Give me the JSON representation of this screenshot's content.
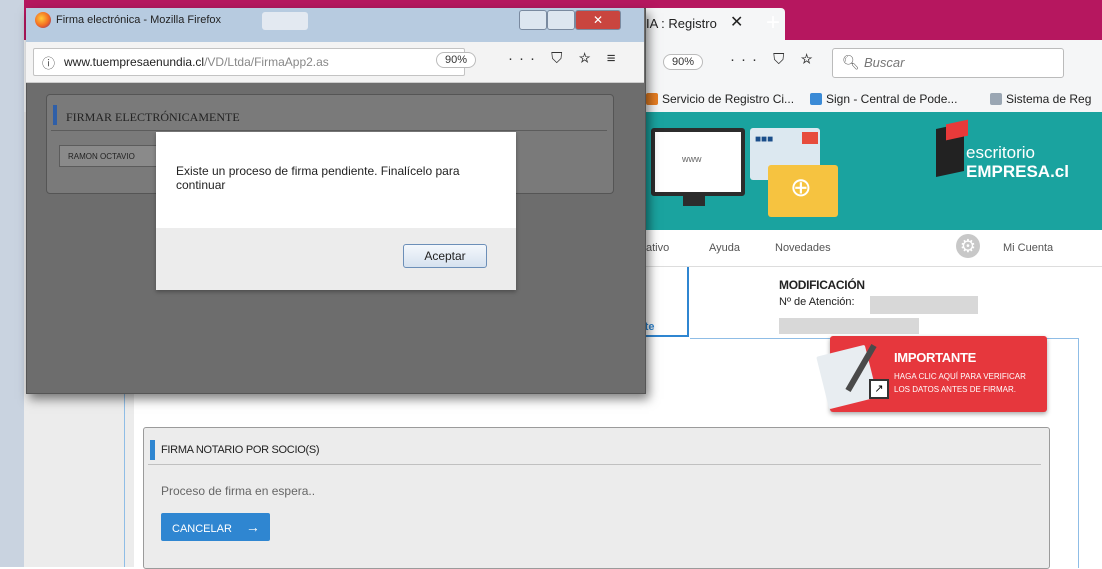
{
  "popup": {
    "title": "Firma electrónica - Mozilla Firefox",
    "url_domain": "www.tuempresaenundia.cl",
    "url_path": "/VD/Ltda/FirmaApp2.as",
    "zoom": "90%",
    "tools": "··· ⛉ ☆ ≡",
    "close_label": "✕"
  },
  "firmar": {
    "title": "FIRMAR ELECTRÓNICAMENTE",
    "signer": "RAMON OCTAVIO"
  },
  "alert": {
    "message": "Existe un proceso de firma pendiente. Finalícelo para continuar",
    "accept_label": "Aceptar"
  },
  "browser": {
    "tab_title": "IA : Registro",
    "tab_close": "✕",
    "new_tab": "+",
    "zoom": "90%",
    "tools": "··· ⛉ ☆",
    "search_placeholder": "Buscar",
    "bookmarks": [
      "Servicio de Registro Ci...",
      "Sign - Central de Pode...",
      "Sistema de Reg"
    ]
  },
  "site": {
    "logo_line1": "escritorio",
    "logo_line2": "EMPRESA.cl",
    "monitor_text": "www",
    "nav": [
      "ativo",
      "Ayuda",
      "Novedades",
      "Mi Cuenta"
    ],
    "tab_label": "nte",
    "modification_title": "MODIFICACIÓN",
    "attention_label": "Nº de Atención:"
  },
  "important": {
    "title": "IMPORTANTE",
    "line1": "HAGA CLIC AQUÍ PARA VERIFICAR",
    "line2": "LOS DATOS ANTES DE FIRMAR."
  },
  "notario": {
    "title": "FIRMA NOTARIO POR SOCIO(S)",
    "status": "Proceso de firma en espera..",
    "cancel_label": "CANCELAR",
    "cancel_arrow": "→"
  },
  "colors": {
    "tab_bar": "#b6175f",
    "site_header": "#1aa39f",
    "important": "#e6373d",
    "accent_blue": "#2f86d1"
  }
}
